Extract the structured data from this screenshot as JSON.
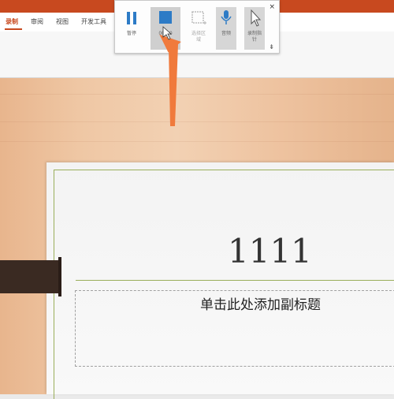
{
  "ribbon": {
    "tabs": [
      {
        "label": "录制"
      },
      {
        "label": "审阅"
      },
      {
        "label": "视图"
      },
      {
        "label": "开发工具"
      }
    ]
  },
  "record_toolbar": {
    "pause_label": "暂停",
    "stop_label": "00:00",
    "select_area_label_1": "选择区",
    "select_area_label_2": "域",
    "audio_label": "音频",
    "record_pointer_label_1": "录制指",
    "record_pointer_label_2": "针",
    "close_glyph": "×",
    "pin_glyph": "⇟"
  },
  "slide": {
    "title": "1111",
    "subtitle": "单击此处添加副标题"
  },
  "colors": {
    "accent": "#c8491f",
    "toolbar_blue": "#2d7bc6",
    "arrow": "#f07a3c",
    "slide_line": "#9aae5a"
  }
}
